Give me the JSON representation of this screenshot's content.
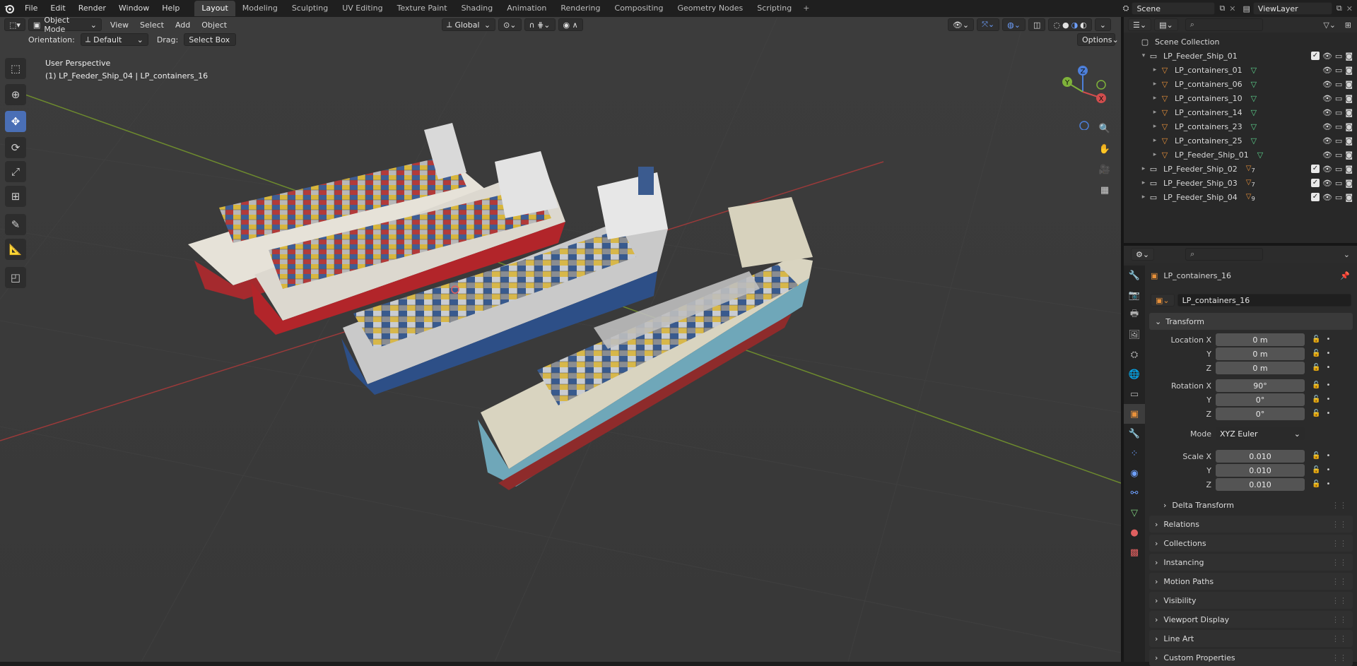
{
  "app": {
    "menus": [
      "File",
      "Edit",
      "Render",
      "Window",
      "Help"
    ],
    "workspaces": [
      "Layout",
      "Modeling",
      "Sculpting",
      "UV Editing",
      "Texture Paint",
      "Shading",
      "Animation",
      "Rendering",
      "Compositing",
      "Geometry Nodes",
      "Scripting"
    ],
    "active_workspace": "Layout",
    "scene": "Scene",
    "view_layer": "ViewLayer"
  },
  "viewport": {
    "mode": "Object Mode",
    "menus": [
      "View",
      "Select",
      "Add",
      "Object"
    ],
    "orientation_label": "Orientation:",
    "orientation_value": "Default",
    "drag_label": "Drag:",
    "drag_value": "Select Box",
    "transform_orientation": "Global",
    "options": "Options",
    "overlay_line1": "User Perspective",
    "overlay_line2": "(1) LP_Feeder_Ship_04 | LP_containers_16",
    "gizmo": {
      "x": "X",
      "y": "Y",
      "z": "Z"
    }
  },
  "outliner": {
    "root": "Scene Collection",
    "items": [
      {
        "label": "LP_Feeder_Ship_01",
        "level": 0,
        "expanded": true,
        "type": "collection"
      },
      {
        "label": "LP_containers_01",
        "level": 1,
        "type": "mesh"
      },
      {
        "label": "LP_containers_06",
        "level": 1,
        "type": "mesh"
      },
      {
        "label": "LP_containers_10",
        "level": 1,
        "type": "mesh"
      },
      {
        "label": "LP_containers_14",
        "level": 1,
        "type": "mesh"
      },
      {
        "label": "LP_containers_23",
        "level": 1,
        "type": "mesh"
      },
      {
        "label": "LP_containers_25",
        "level": 1,
        "type": "mesh"
      },
      {
        "label": "LP_Feeder_Ship_01",
        "level": 1,
        "type": "mesh"
      },
      {
        "label": "LP_Feeder_Ship_02",
        "level": 0,
        "expanded": false,
        "type": "collection",
        "count": "7"
      },
      {
        "label": "LP_Feeder_Ship_03",
        "level": 0,
        "expanded": false,
        "type": "collection",
        "count": "7"
      },
      {
        "label": "LP_Feeder_Ship_04",
        "level": 0,
        "expanded": false,
        "type": "collection",
        "count": "9"
      }
    ]
  },
  "properties": {
    "object_name": "LP_containers_16",
    "datablock": "LP_containers_16",
    "transform": {
      "title": "Transform",
      "location_x_label": "Location X",
      "location_x": "0 m",
      "location_y_label": "Y",
      "location_y": "0 m",
      "location_z_label": "Z",
      "location_z": "0 m",
      "rotation_x_label": "Rotation X",
      "rotation_x": "90°",
      "rotation_y_label": "Y",
      "rotation_y": "0°",
      "rotation_z_label": "Z",
      "rotation_z": "0°",
      "mode_label": "Mode",
      "mode": "XYZ Euler",
      "scale_x_label": "Scale X",
      "scale_x": "0.010",
      "scale_y_label": "Y",
      "scale_y": "0.010",
      "scale_z_label": "Z",
      "scale_z": "0.010"
    },
    "panels": [
      "Delta Transform",
      "Relations",
      "Collections",
      "Instancing",
      "Motion Paths",
      "Visibility",
      "Viewport Display",
      "Line Art",
      "Custom Properties"
    ]
  },
  "colors": {
    "accent": "#4a6fb6",
    "viewport_bg": "#3a3a3a",
    "ship_red": "#b2252a",
    "ship_blue": "#2d4f87",
    "ship_teal": "#6fa7b9"
  }
}
